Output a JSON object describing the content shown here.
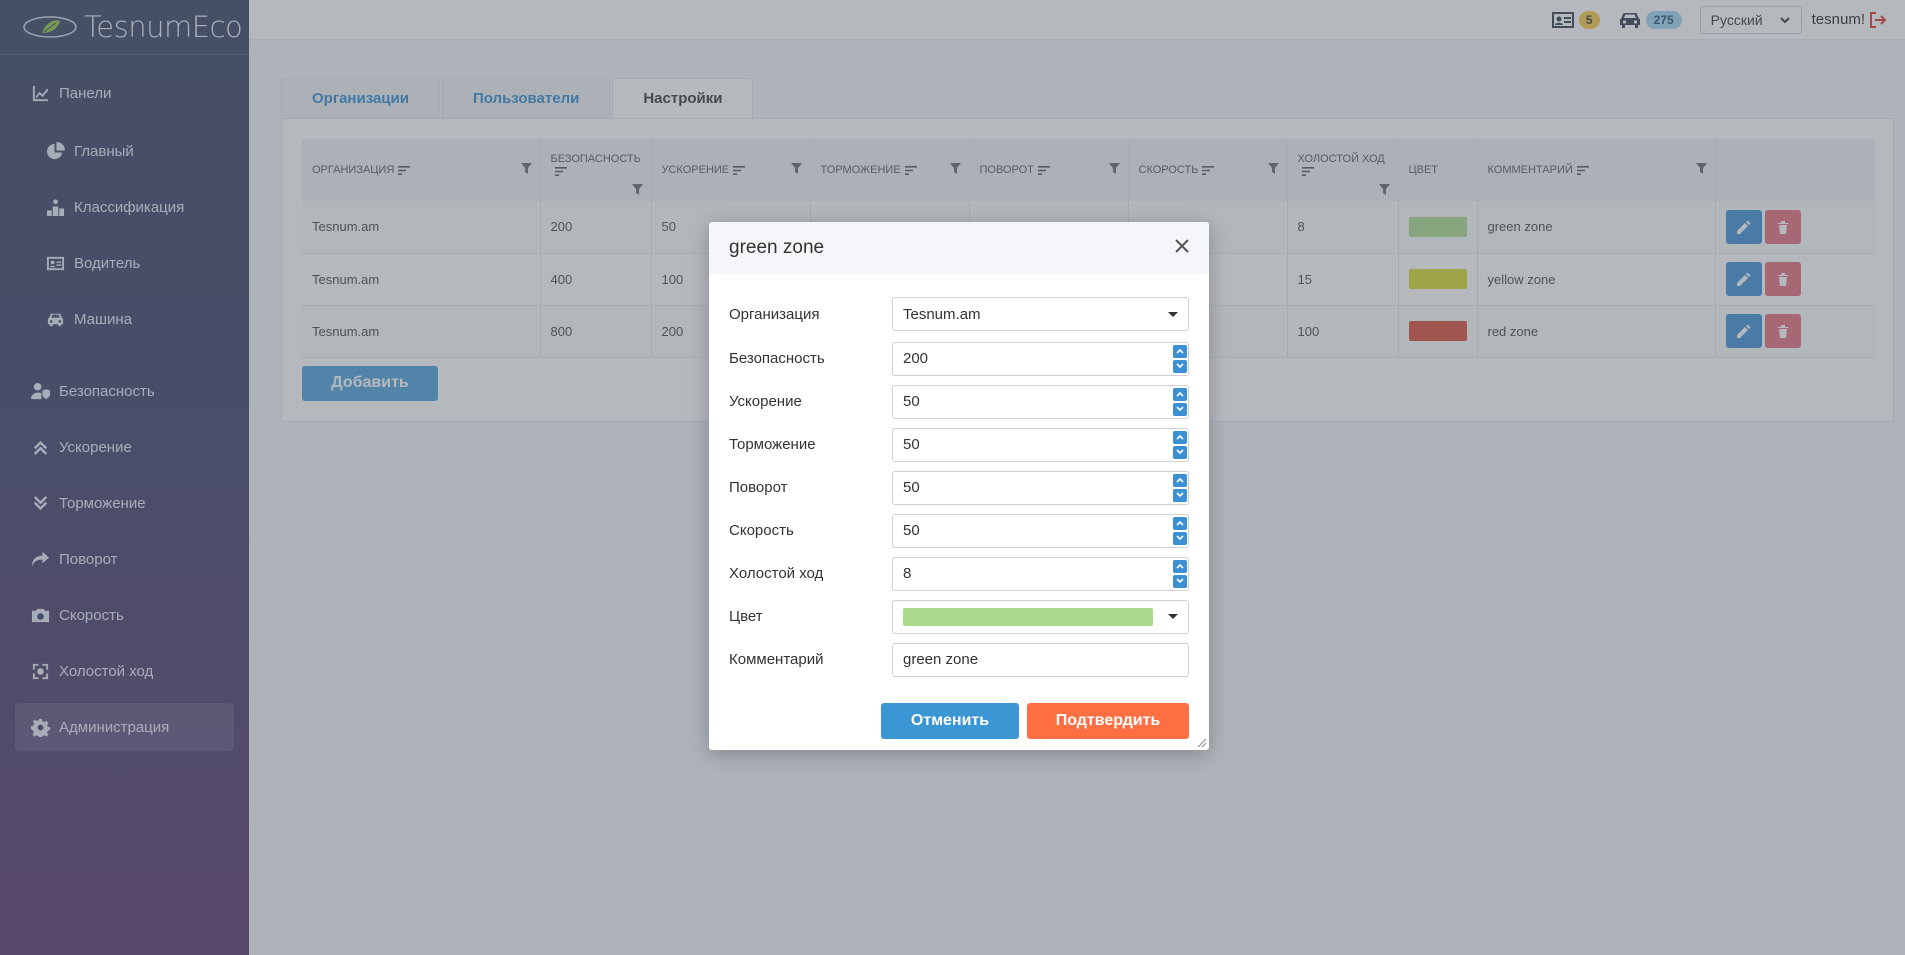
{
  "brand": {
    "name": "TesnumEco"
  },
  "sidebar": {
    "items": [
      {
        "label": "Панели",
        "icon": "chart-line-icon"
      },
      {
        "label": "Главный",
        "icon": "pie-chart-icon"
      },
      {
        "label": "Классификация",
        "icon": "podium-icon"
      },
      {
        "label": "Водитель",
        "icon": "id-card-icon"
      },
      {
        "label": "Машина",
        "icon": "car-icon"
      },
      {
        "label": "Безопасность",
        "icon": "user-shield-icon"
      },
      {
        "label": "Ускорение",
        "icon": "chevrons-up-icon"
      },
      {
        "label": "Торможение",
        "icon": "chevrons-down-icon"
      },
      {
        "label": "Поворот",
        "icon": "share-arrow-icon"
      },
      {
        "label": "Скорость",
        "icon": "camera-icon"
      },
      {
        "label": "Холостой ход",
        "icon": "recycle-icon"
      },
      {
        "label": "Администрация",
        "icon": "gear-icon"
      }
    ]
  },
  "topbar": {
    "drivers_count": "5",
    "cars_count": "275",
    "language": "Русский",
    "username": "tesnum!"
  },
  "tabs": [
    "Организации",
    "Пользователи",
    "Настройки"
  ],
  "table": {
    "headers": [
      "Организация",
      "Безопасность",
      "Ускорение",
      "Торможение",
      "Поворот",
      "Скорость",
      "Холостой ход",
      "Цвет",
      "Комментарий"
    ],
    "rows": [
      {
        "org": "Tesnum.am",
        "safety": "200",
        "accel": "50",
        "idle": "8",
        "color": "#a9d98b",
        "comment": "green zone"
      },
      {
        "org": "Tesnum.am",
        "safety": "400",
        "accel": "100",
        "idle": "15",
        "color": "#d7d92f",
        "comment": "yellow zone"
      },
      {
        "org": "Tesnum.am",
        "safety": "800",
        "accel": "200",
        "idle": "100",
        "color": "#d94a33",
        "comment": "red zone"
      }
    ],
    "add_label": "Добавить"
  },
  "modal": {
    "title": "green zone",
    "fields": {
      "org_label": "Организация",
      "org_value": "Tesnum.am",
      "safety_label": "Безопасность",
      "safety_value": "200",
      "accel_label": "Ускорение",
      "accel_value": "50",
      "brake_label": "Торможение",
      "brake_value": "50",
      "turn_label": "Поворот",
      "turn_value": "50",
      "speed_label": "Скорость",
      "speed_value": "50",
      "idle_label": "Холостой ход",
      "idle_value": "8",
      "color_label": "Цвет",
      "color_value": "#a9d98b",
      "comment_label": "Комментарий",
      "comment_value": "green zone"
    },
    "cancel_label": "Отменить",
    "confirm_label": "Подтвердить"
  }
}
